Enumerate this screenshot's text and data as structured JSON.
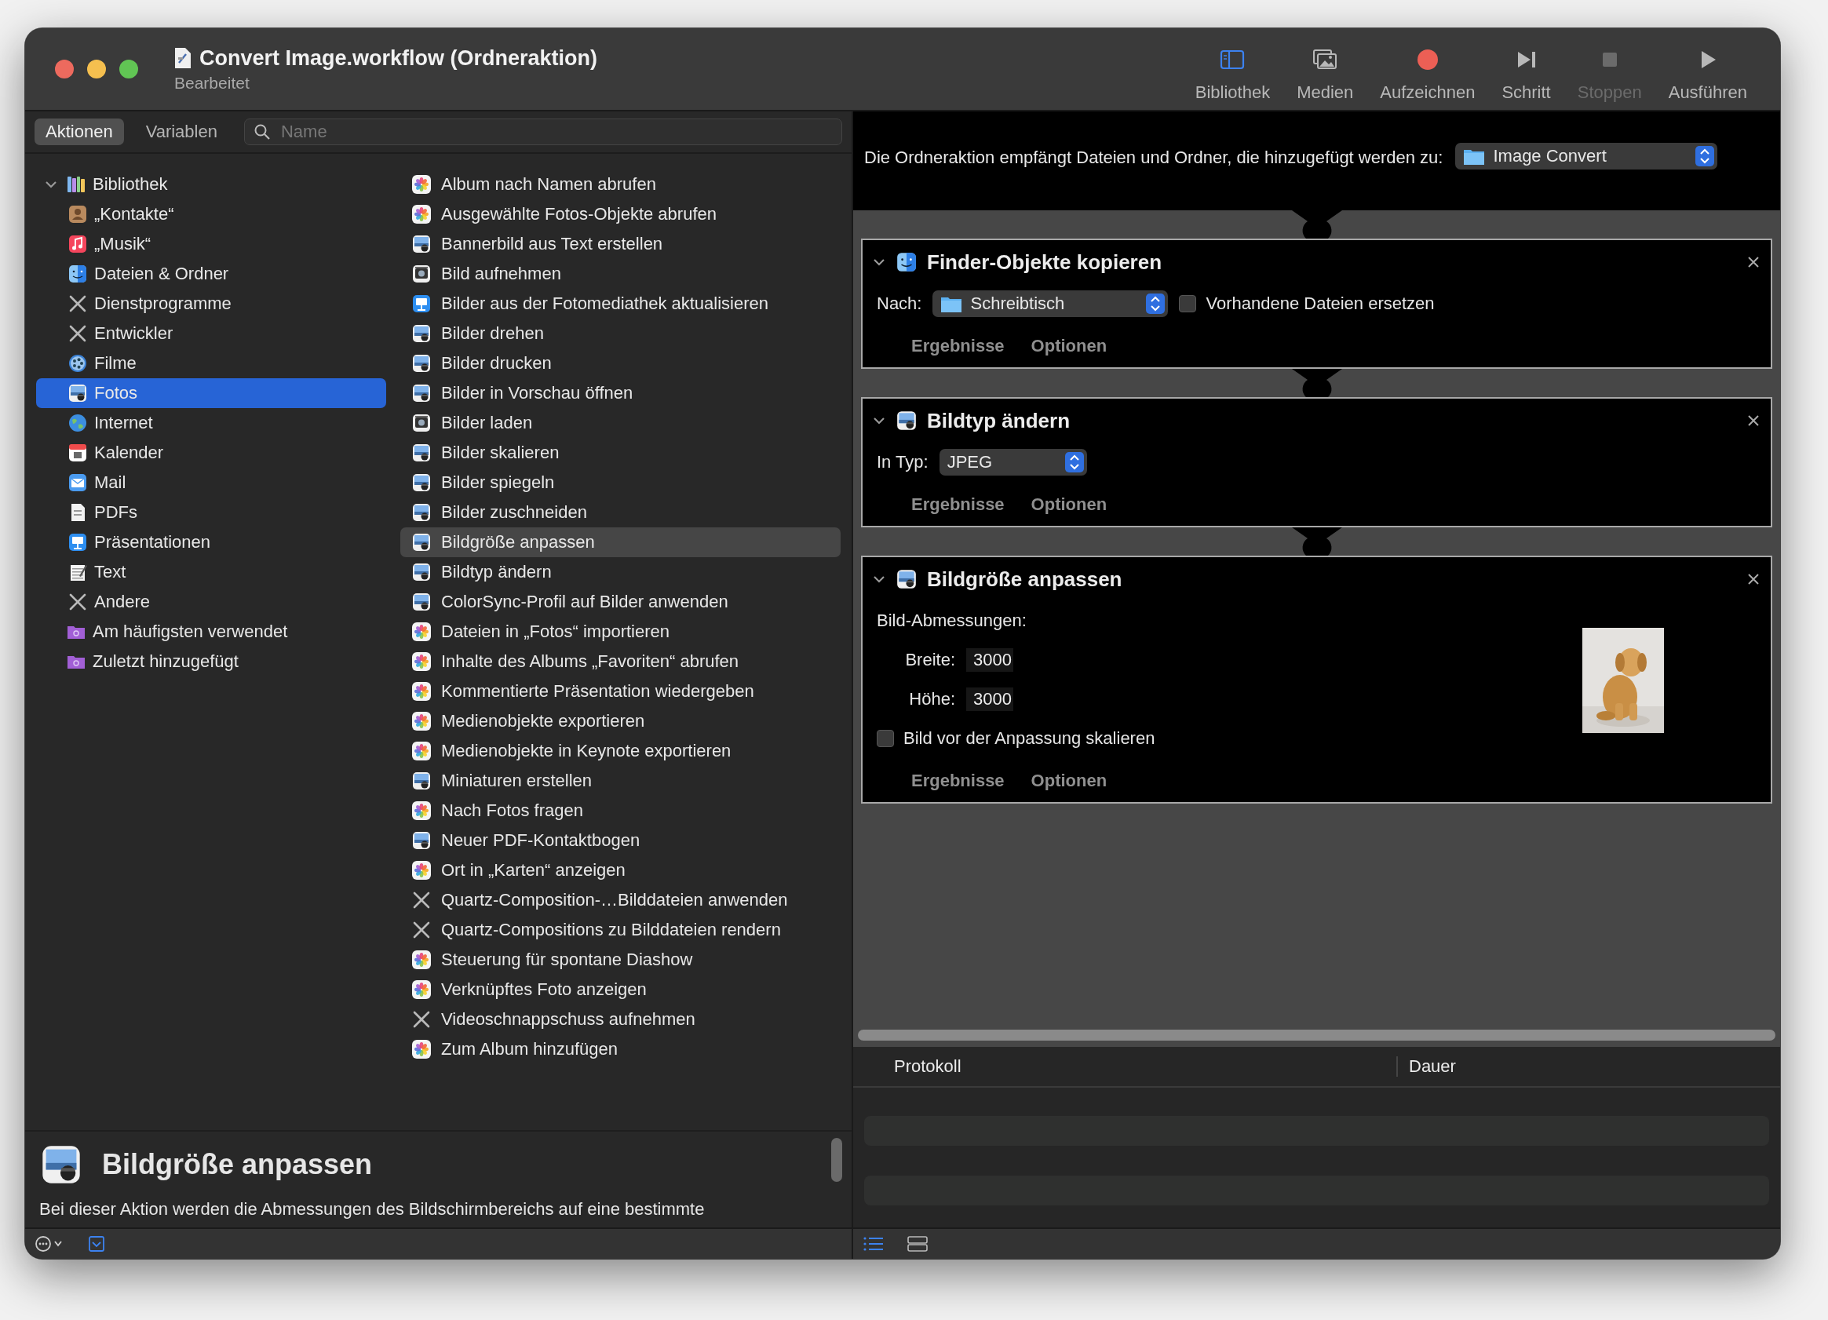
{
  "window": {
    "title": "Convert Image.workflow (Ordneraktion)",
    "subtitle": "Bearbeitet"
  },
  "toolbar": {
    "items": [
      {
        "label": "Bibliothek",
        "kind": "library",
        "on": true,
        "disabled": false
      },
      {
        "label": "Medien",
        "kind": "media",
        "on": false,
        "disabled": false
      },
      {
        "label": "Aufzeichnen",
        "kind": "record",
        "on": false,
        "disabled": false
      },
      {
        "label": "Schritt",
        "kind": "step",
        "on": false,
        "disabled": false
      },
      {
        "label": "Stoppen",
        "kind": "stop",
        "on": false,
        "disabled": true
      },
      {
        "label": "Ausführen",
        "kind": "run",
        "on": false,
        "disabled": false
      }
    ]
  },
  "library_tabs": [
    {
      "label": "Aktionen",
      "selected": true
    },
    {
      "label": "Variablen",
      "selected": false
    }
  ],
  "search": {
    "placeholder": "Name"
  },
  "library": {
    "items": [
      {
        "label": "Bibliothek",
        "kind": "books",
        "selected": false,
        "expanded": true,
        "children": [
          {
            "label": "„Kontakte“",
            "kind": "contacts",
            "selected": false
          },
          {
            "label": "„Musik“",
            "kind": "music",
            "selected": false
          },
          {
            "label": "Dateien & Ordner",
            "kind": "finder",
            "selected": false
          },
          {
            "label": "Dienstprogramme",
            "kind": "tools",
            "selected": false
          },
          {
            "label": "Entwickler",
            "kind": "tools",
            "selected": false
          },
          {
            "label": "Filme",
            "kind": "film",
            "selected": false
          },
          {
            "label": "Fotos",
            "kind": "preview",
            "selected": true
          },
          {
            "label": "Internet",
            "kind": "globe",
            "selected": false
          },
          {
            "label": "Kalender",
            "kind": "calendar",
            "selected": false
          },
          {
            "label": "Mail",
            "kind": "mail",
            "selected": false
          },
          {
            "label": "PDFs",
            "kind": "pdf",
            "selected": false
          },
          {
            "label": "Präsentationen",
            "kind": "keynote",
            "selected": false
          },
          {
            "label": "Text",
            "kind": "text",
            "selected": false
          },
          {
            "label": "Andere",
            "kind": "tools",
            "selected": false
          }
        ]
      },
      {
        "label": "Am häufigsten verwendet",
        "kind": "smartfolder",
        "selected": false
      },
      {
        "label": "Zuletzt hinzugefügt",
        "kind": "smartfolder",
        "selected": false
      }
    ]
  },
  "actions_list": {
    "items": [
      {
        "label": "Album nach Namen abrufen",
        "kind": "photos",
        "selected": false
      },
      {
        "label": "Ausgewählte Fotos-Objekte abrufen",
        "kind": "photos",
        "selected": false
      },
      {
        "label": "Bannerbild aus Text erstellen",
        "kind": "preview",
        "selected": false
      },
      {
        "label": "Bild aufnehmen",
        "kind": "camera",
        "selected": false
      },
      {
        "label": "Bilder aus der Fotomediathek aktualisieren",
        "kind": "keynote",
        "selected": false
      },
      {
        "label": "Bilder drehen",
        "kind": "preview",
        "selected": false
      },
      {
        "label": "Bilder drucken",
        "kind": "preview",
        "selected": false
      },
      {
        "label": "Bilder in Vorschau öffnen",
        "kind": "preview",
        "selected": false
      },
      {
        "label": "Bilder laden",
        "kind": "camera",
        "selected": false
      },
      {
        "label": "Bilder skalieren",
        "kind": "preview",
        "selected": false
      },
      {
        "label": "Bilder spiegeln",
        "kind": "preview",
        "selected": false
      },
      {
        "label": "Bilder zuschneiden",
        "kind": "preview",
        "selected": false
      },
      {
        "label": "Bildgröße anpassen",
        "kind": "preview",
        "selected": true
      },
      {
        "label": "Bildtyp ändern",
        "kind": "preview",
        "selected": false
      },
      {
        "label": "ColorSync-Profil auf Bilder anwenden",
        "kind": "preview",
        "selected": false
      },
      {
        "label": "Dateien in „Fotos“ importieren",
        "kind": "photos",
        "selected": false
      },
      {
        "label": "Inhalte des Albums „Favoriten“ abrufen",
        "kind": "photos",
        "selected": false
      },
      {
        "label": "Kommentierte Präsentation wiedergeben",
        "kind": "photos",
        "selected": false
      },
      {
        "label": "Medienobjekte exportieren",
        "kind": "photos",
        "selected": false
      },
      {
        "label": "Medienobjekte in Keynote exportieren",
        "kind": "photos",
        "selected": false
      },
      {
        "label": "Miniaturen erstellen",
        "kind": "preview",
        "selected": false
      },
      {
        "label": "Nach Fotos fragen",
        "kind": "photos",
        "selected": false
      },
      {
        "label": "Neuer PDF-Kontaktbogen",
        "kind": "preview",
        "selected": false
      },
      {
        "label": "Ort in „Karten“ anzeigen",
        "kind": "photos",
        "selected": false
      },
      {
        "label": "Quartz-Composition-…Bilddateien anwenden",
        "kind": "tools",
        "selected": false
      },
      {
        "label": "Quartz-Compositions zu Bilddateien rendern",
        "kind": "tools",
        "selected": false
      },
      {
        "label": "Steuerung für spontane Diashow",
        "kind": "photos",
        "selected": false
      },
      {
        "label": "Verknüpftes Foto anzeigen",
        "kind": "photos",
        "selected": false
      },
      {
        "label": "Videoschnappschuss aufnehmen",
        "kind": "tools",
        "selected": false
      },
      {
        "label": "Zum Album hinzufügen",
        "kind": "photos",
        "selected": false
      }
    ]
  },
  "description": {
    "title": "Bildgröße anpassen",
    "text": "Bei dieser Aktion werden die Abmessungen des Bildschirmbereichs auf eine bestimmte"
  },
  "workflow": {
    "input_label": "Die Ordneraktion empfängt Dateien und Ordner, die hinzugefügt werden zu:",
    "input_folder": "Image Convert",
    "actions": [
      {
        "title": "Finder-Objekte kopieren",
        "kind": "finder",
        "expanded": true,
        "rows": [
          {
            "controls": [
              {
                "kind": "popup",
                "label": "Nach:",
                "value": "Schreibtisch",
                "folder": true
              },
              {
                "kind": "checkbox",
                "label": "Vorhandene Dateien ersetzen",
                "checked": false
              }
            ]
          }
        ],
        "tabs": [
          "Ergebnisse",
          "Optionen"
        ]
      },
      {
        "title": "Bildtyp ändern",
        "kind": "preview",
        "expanded": true,
        "rows": [
          {
            "controls": [
              {
                "kind": "popup",
                "label": "In Typ:",
                "value": "JPEG",
                "folder": false
              }
            ]
          }
        ],
        "tabs": [
          "Ergebnisse",
          "Optionen"
        ]
      },
      {
        "title": "Bildgröße anpassen",
        "kind": "preview",
        "expanded": true,
        "preview": {
          "kind": "picture"
        },
        "rows": [
          {
            "controls": [
              {
                "kind": "heading",
                "label": "Bild-Abmessungen:"
              }
            ]
          },
          {
            "controls": [
              {
                "kind": "number",
                "label": "Breite:",
                "value": "3000"
              }
            ]
          },
          {
            "controls": [
              {
                "kind": "number",
                "label": "Höhe:",
                "value": "3000"
              }
            ]
          },
          {
            "controls": [
              {
                "kind": "checkbox",
                "label": "Bild vor der Anpassung skalieren",
                "checked": false
              }
            ]
          }
        ],
        "tabs": [
          "Ergebnisse",
          "Optionen"
        ]
      }
    ]
  },
  "log": {
    "columns": [
      "Protokoll",
      "Dauer"
    ]
  }
}
